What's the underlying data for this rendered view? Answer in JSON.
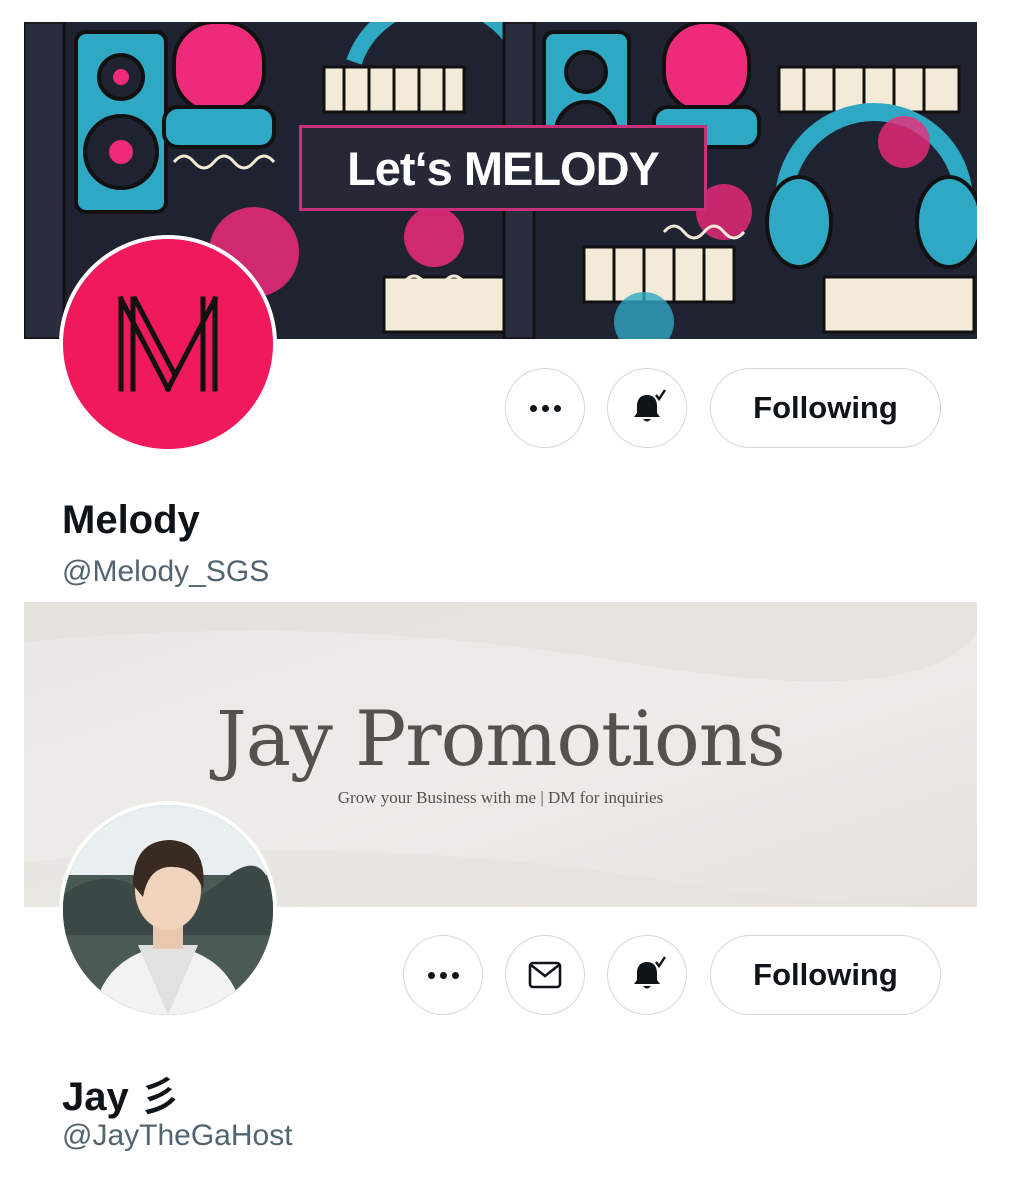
{
  "profiles": [
    {
      "banner_text": "Let‘s MELODY",
      "name": "Melody",
      "handle": "@Melody_SGS",
      "follow_label": "Following",
      "buttons": [
        "more",
        "notifications"
      ],
      "avatar_color": "#f0195c"
    },
    {
      "banner_title": "Jay Promotions",
      "banner_subtitle": "Grow your Business with me | DM for inquiries",
      "name": "Jay 彡",
      "handle": "@JayTheGaHost",
      "follow_label": "Following",
      "buttons": [
        "more",
        "message",
        "notifications"
      ]
    }
  ],
  "icons": {
    "more": "more-dots-icon",
    "message": "envelope-icon",
    "notifications": "bell-check-icon"
  },
  "colors": {
    "text_primary": "#0f1419",
    "text_secondary": "#536471",
    "button_border": "#cfd9de",
    "melody_pink": "#f0195c"
  }
}
